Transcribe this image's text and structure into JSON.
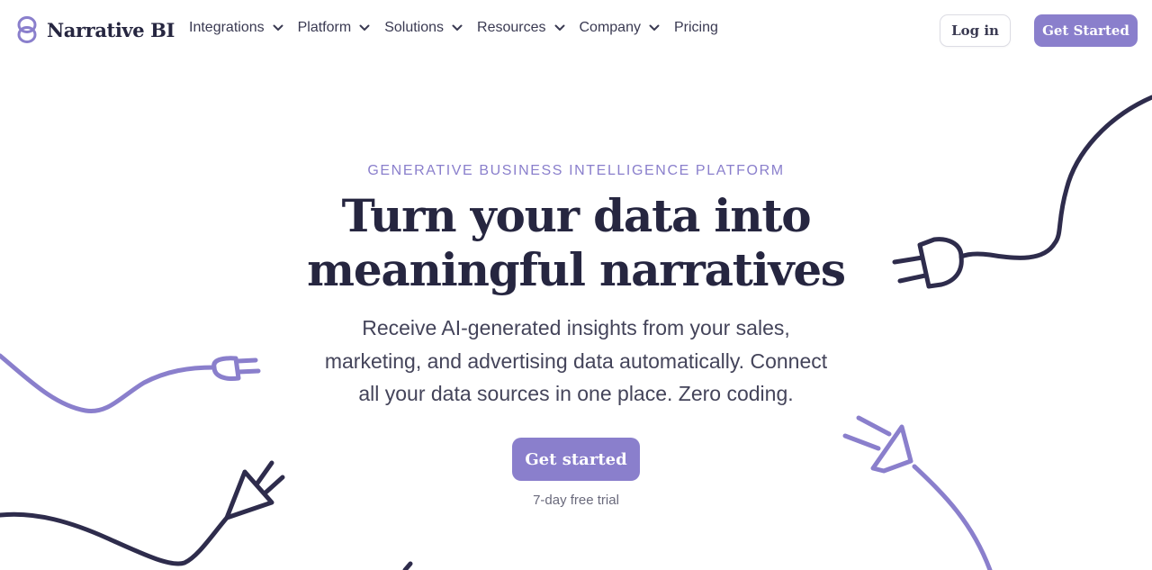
{
  "brand": {
    "name": "Narrative BI",
    "logo_icon": "interlocked-rings-icon",
    "accent_color": "#8a7fcc",
    "text_color": "#262640"
  },
  "nav": {
    "items": [
      {
        "label": "Integrations",
        "has_dropdown": true
      },
      {
        "label": "Platform",
        "has_dropdown": true
      },
      {
        "label": "Solutions",
        "has_dropdown": true
      },
      {
        "label": "Resources",
        "has_dropdown": true
      },
      {
        "label": "Company",
        "has_dropdown": true
      },
      {
        "label": "Pricing",
        "has_dropdown": false
      }
    ],
    "login_label": "Log in",
    "get_started_label": "Get Started"
  },
  "hero": {
    "eyebrow": "GENERATIVE BUSINESS INTELLIGENCE PLATFORM",
    "headline_line1": "Turn your data into",
    "headline_line2": "meaningful narratives",
    "subtext_line1": "Receive AI-generated insights from your sales,",
    "subtext_line2": "marketing, and advertising data automatically. Connect",
    "subtext_line3": "all your data sources in one place. Zero coding.",
    "cta_label": "Get started",
    "trial_note": "7-day free trial"
  },
  "decorations": [
    {
      "name": "plug-dark-top-right",
      "color": "#2e2c4c"
    },
    {
      "name": "plug-purple-left",
      "color": "#8a7fcc"
    },
    {
      "name": "plug-dark-bottom-left",
      "color": "#2e2c4c"
    },
    {
      "name": "plug-purple-bottom-right",
      "color": "#8a7fcc"
    }
  ]
}
